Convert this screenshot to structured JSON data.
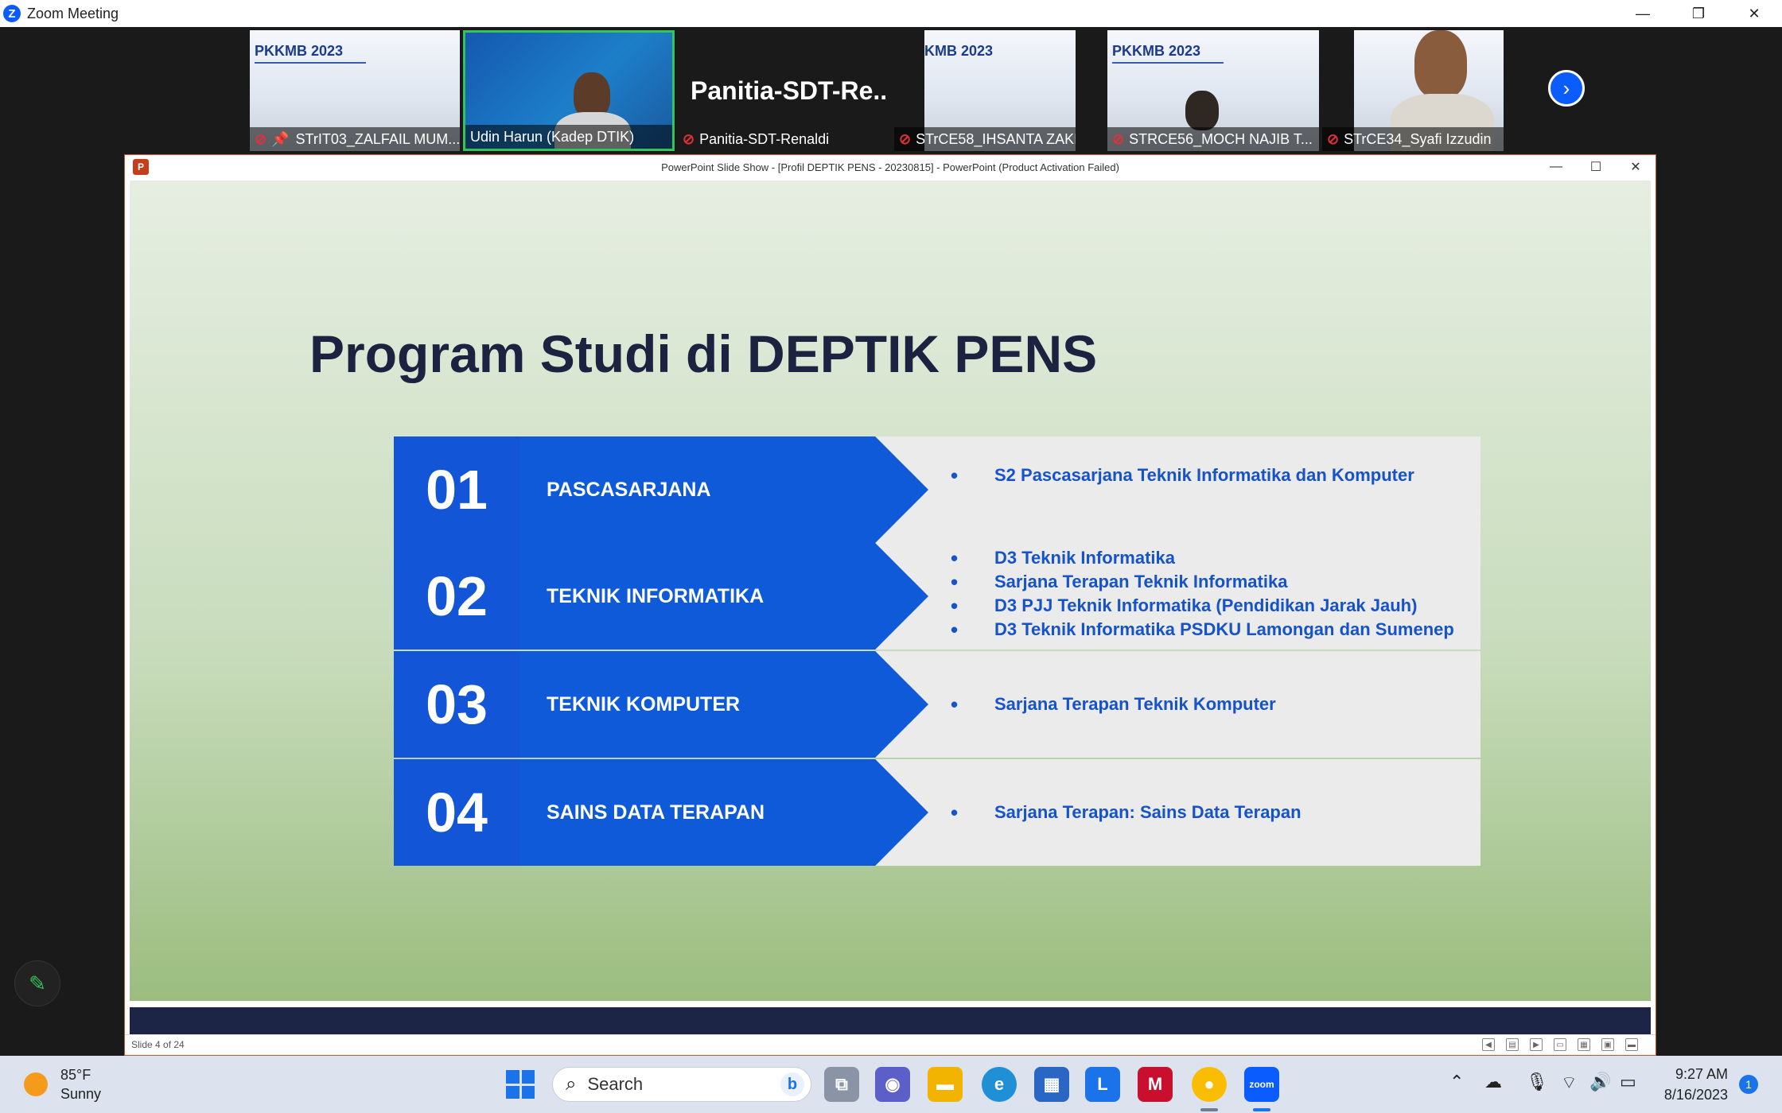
{
  "zoom": {
    "window_title": "Zoom Meeting",
    "logo_letter": "Z",
    "controls": {
      "minimize": "—",
      "restore": "❐",
      "close": "✕"
    }
  },
  "participants": [
    {
      "name": "STrIT03_ZALFAIL MUM...",
      "muted": true,
      "pinned": true,
      "content": "slide",
      "slide_text": "PKKMB 2023"
    },
    {
      "name": "Udin Harun (Kadep DTIK)",
      "muted": false,
      "active_speaker": true,
      "content": "video"
    },
    {
      "name": "Panitia-SDT-Renaldi",
      "muted": true,
      "content": "name-card",
      "display_name": "Panitia-SDT-Re..."
    },
    {
      "name": "STrCE58_IHSANTA ZAKI",
      "muted": true,
      "content": "slide",
      "slide_text": "KMB 2023"
    },
    {
      "name": "STRCE56_MOCH NAJIB T...",
      "muted": true,
      "content": "slide",
      "slide_text": "PKKMB 2023"
    },
    {
      "name": "STrCE34_Syafi Izzudin",
      "muted": true,
      "content": "video"
    }
  ],
  "gallery_next_icon": "chevron-right-icon",
  "powerpoint": {
    "window_title": "PowerPoint Slide Show - [Profil DEPTIK PENS - 20230815] - PowerPoint (Product Activation Failed)",
    "icon_letter": "P",
    "controls": {
      "minimize": "—",
      "maximize": "☐",
      "close": "✕"
    },
    "status_slide": "Slide 4 of 24"
  },
  "slide": {
    "title": "Program Studi di DEPTIK PENS",
    "rows": [
      {
        "number": "01",
        "label": "PASCASARJANA",
        "items": [
          "S2 Pascasarjana Teknik Informatika dan Komputer"
        ]
      },
      {
        "number": "02",
        "label": "TEKNIK INFORMATIKA",
        "items": [
          "D3 Teknik Informatika",
          "Sarjana Terapan Teknik Informatika",
          "D3 PJJ Teknik Informatika (Pendidikan Jarak Jauh)",
          "D3 Teknik Informatika PSDKU Lamongan dan Sumenep"
        ]
      },
      {
        "number": "03",
        "label": "TEKNIK KOMPUTER",
        "items": [
          "Sarjana Terapan Teknik Komputer"
        ]
      },
      {
        "number": "04",
        "label": "SAINS DATA TERAPAN",
        "items": [
          "Sarjana Terapan: Sains Data Terapan"
        ]
      }
    ],
    "colors": {
      "number_bg": "#1255d6",
      "arrow_bg": "#0e5ad8",
      "bullet_text": "#1653c9",
      "title": "#1c2340"
    }
  },
  "taskbar": {
    "weather_temp": "85°F",
    "weather_desc": "Sunny",
    "search_placeholder": "Search",
    "time": "9:27 AM",
    "date": "8/16/2023",
    "notification_count": "1"
  }
}
